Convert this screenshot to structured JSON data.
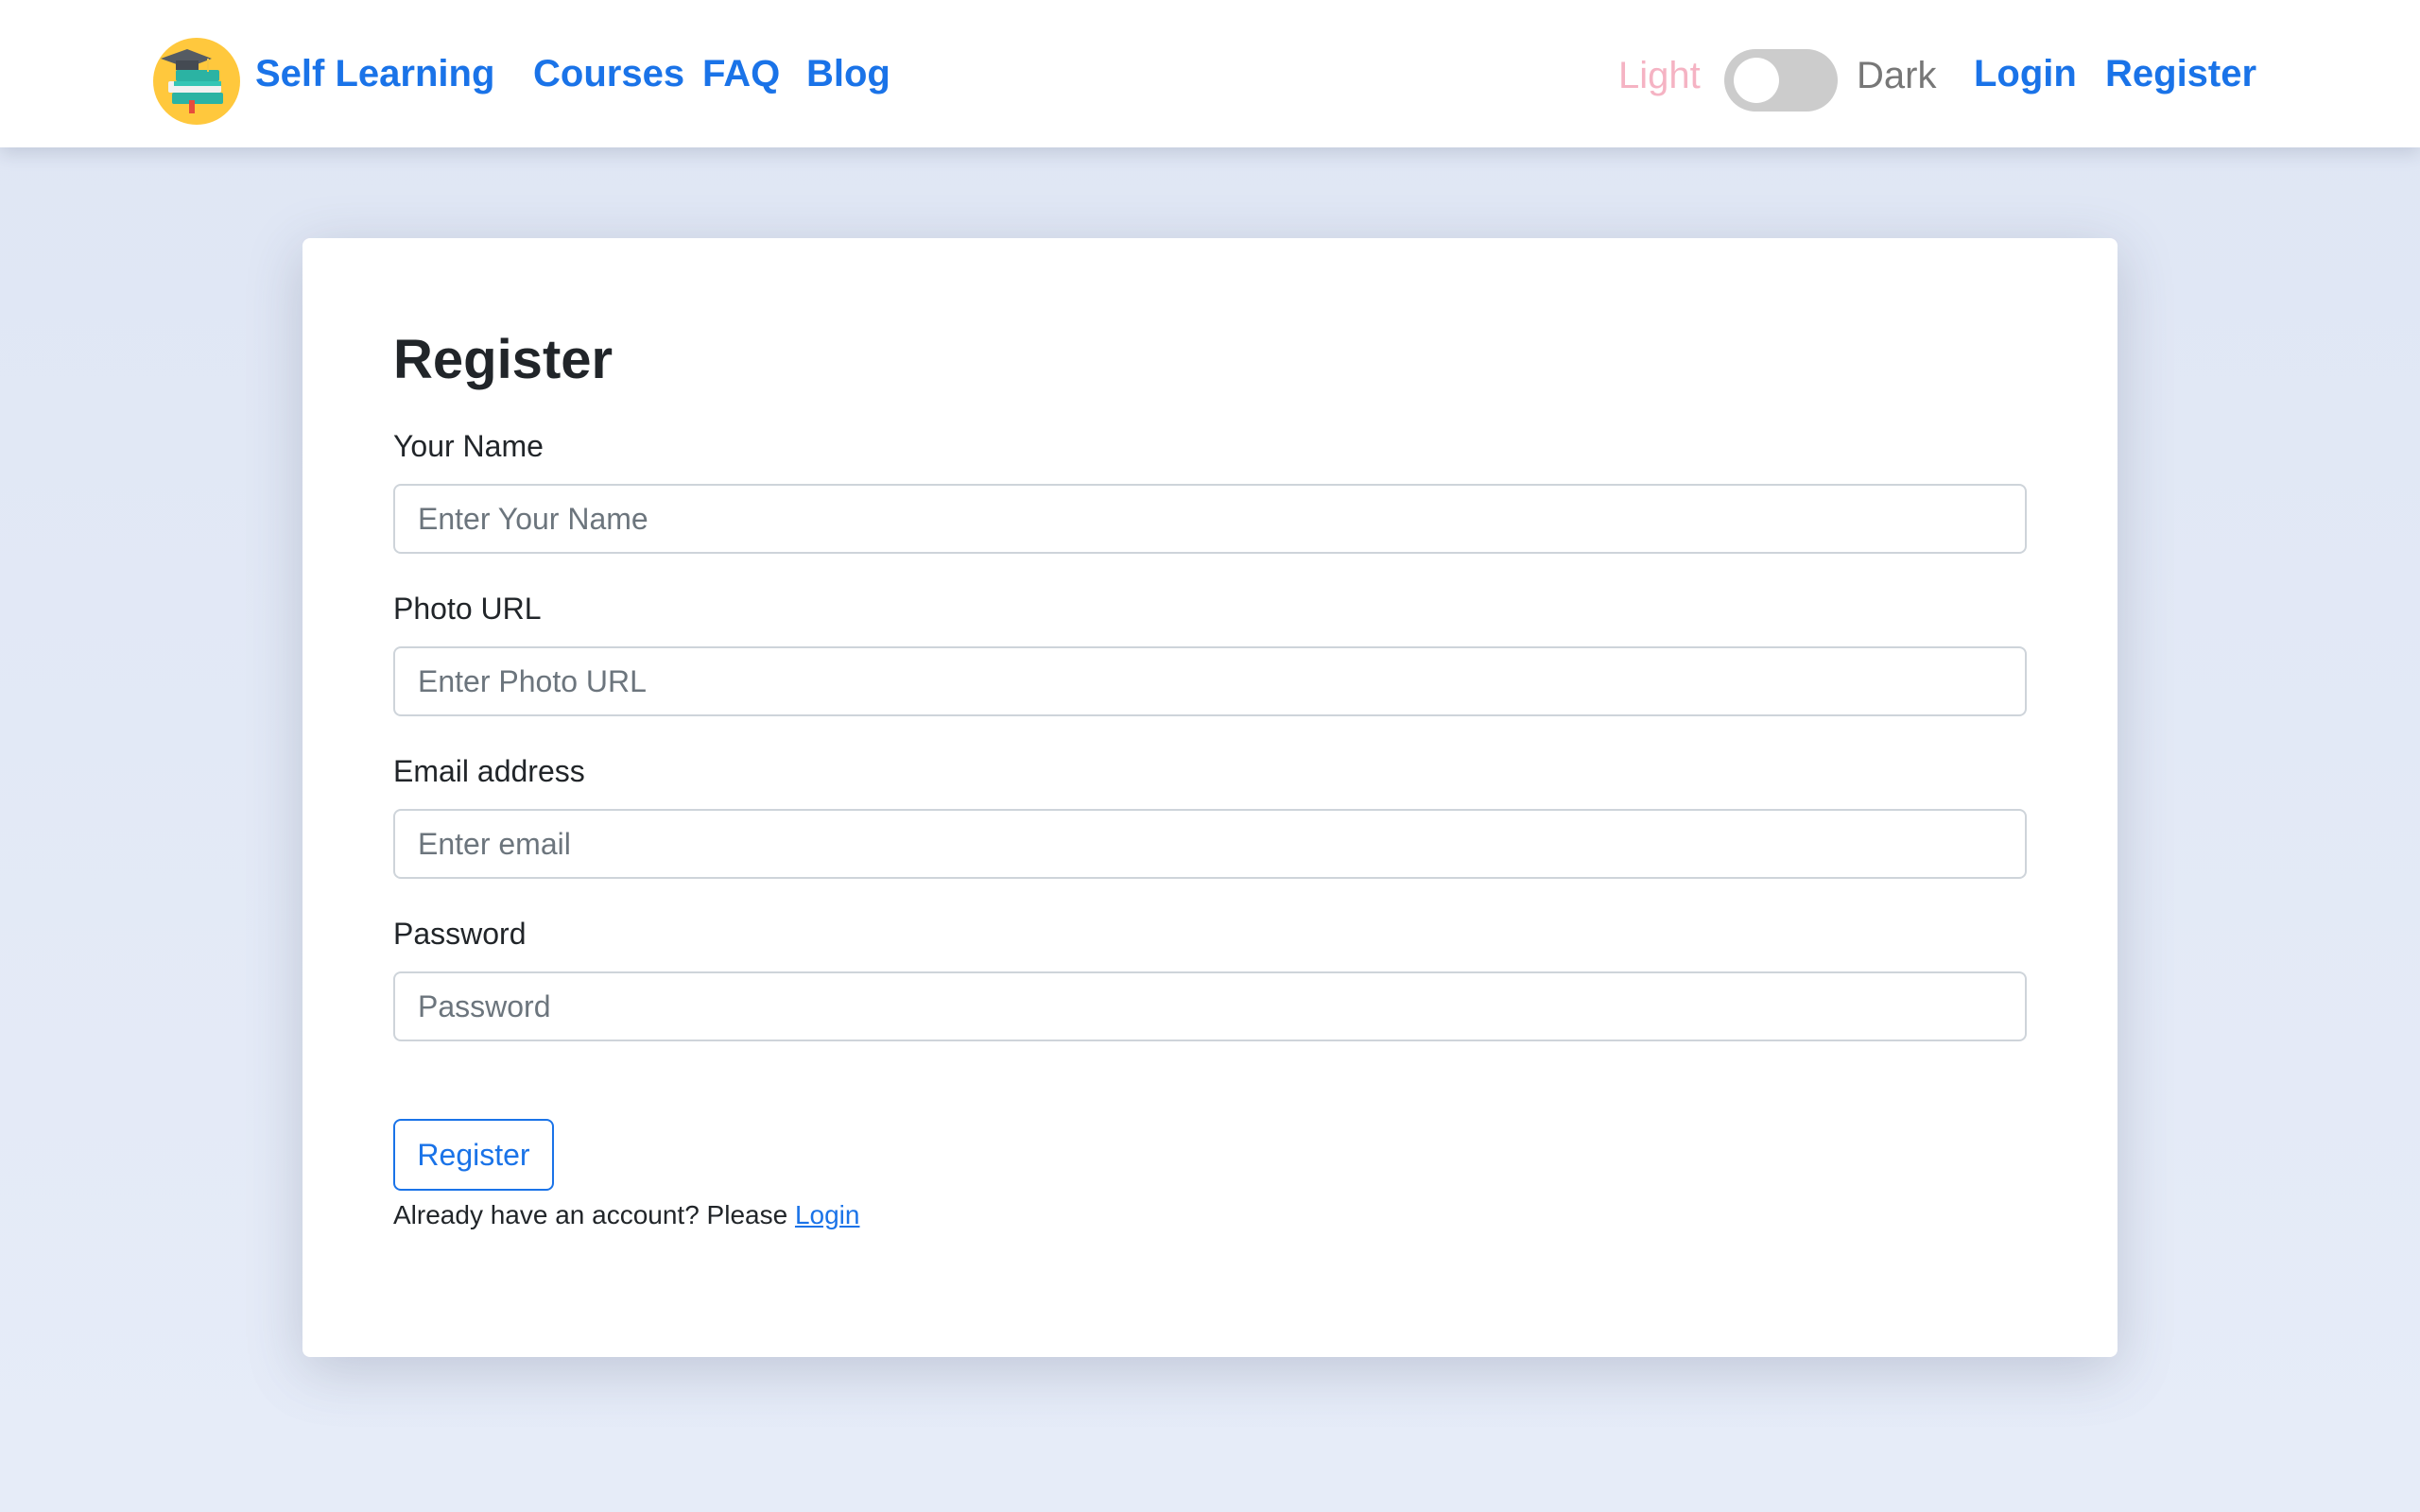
{
  "navbar": {
    "brand_name": "Self Learning",
    "logo_icon": "graduation-cap-books-icon",
    "links": {
      "courses": "Courses",
      "faq": "FAQ",
      "blog": "Blog",
      "login": "Login",
      "register": "Register"
    },
    "theme": {
      "light_label": "Light",
      "dark_label": "Dark",
      "current": "light"
    }
  },
  "form": {
    "title": "Register",
    "fields": {
      "name": {
        "label": "Your Name",
        "placeholder": "Enter Your Name",
        "value": ""
      },
      "photo_url": {
        "label": "Photo URL",
        "placeholder": "Enter Photo URL",
        "value": ""
      },
      "email": {
        "label": "Email address",
        "placeholder": "Enter email",
        "value": ""
      },
      "password": {
        "label": "Password",
        "placeholder": "Password",
        "value": ""
      }
    },
    "submit_label": "Register",
    "login_prompt": "Already have an account? Please",
    "login_link": "Login"
  },
  "colors": {
    "accent": "#1a73e8",
    "light_label": "#f5b3c3",
    "dark_label": "#777777",
    "page_background": "#e4eaf6",
    "toggle_track": "#cccccc",
    "logo_background": "#ffc83d"
  }
}
